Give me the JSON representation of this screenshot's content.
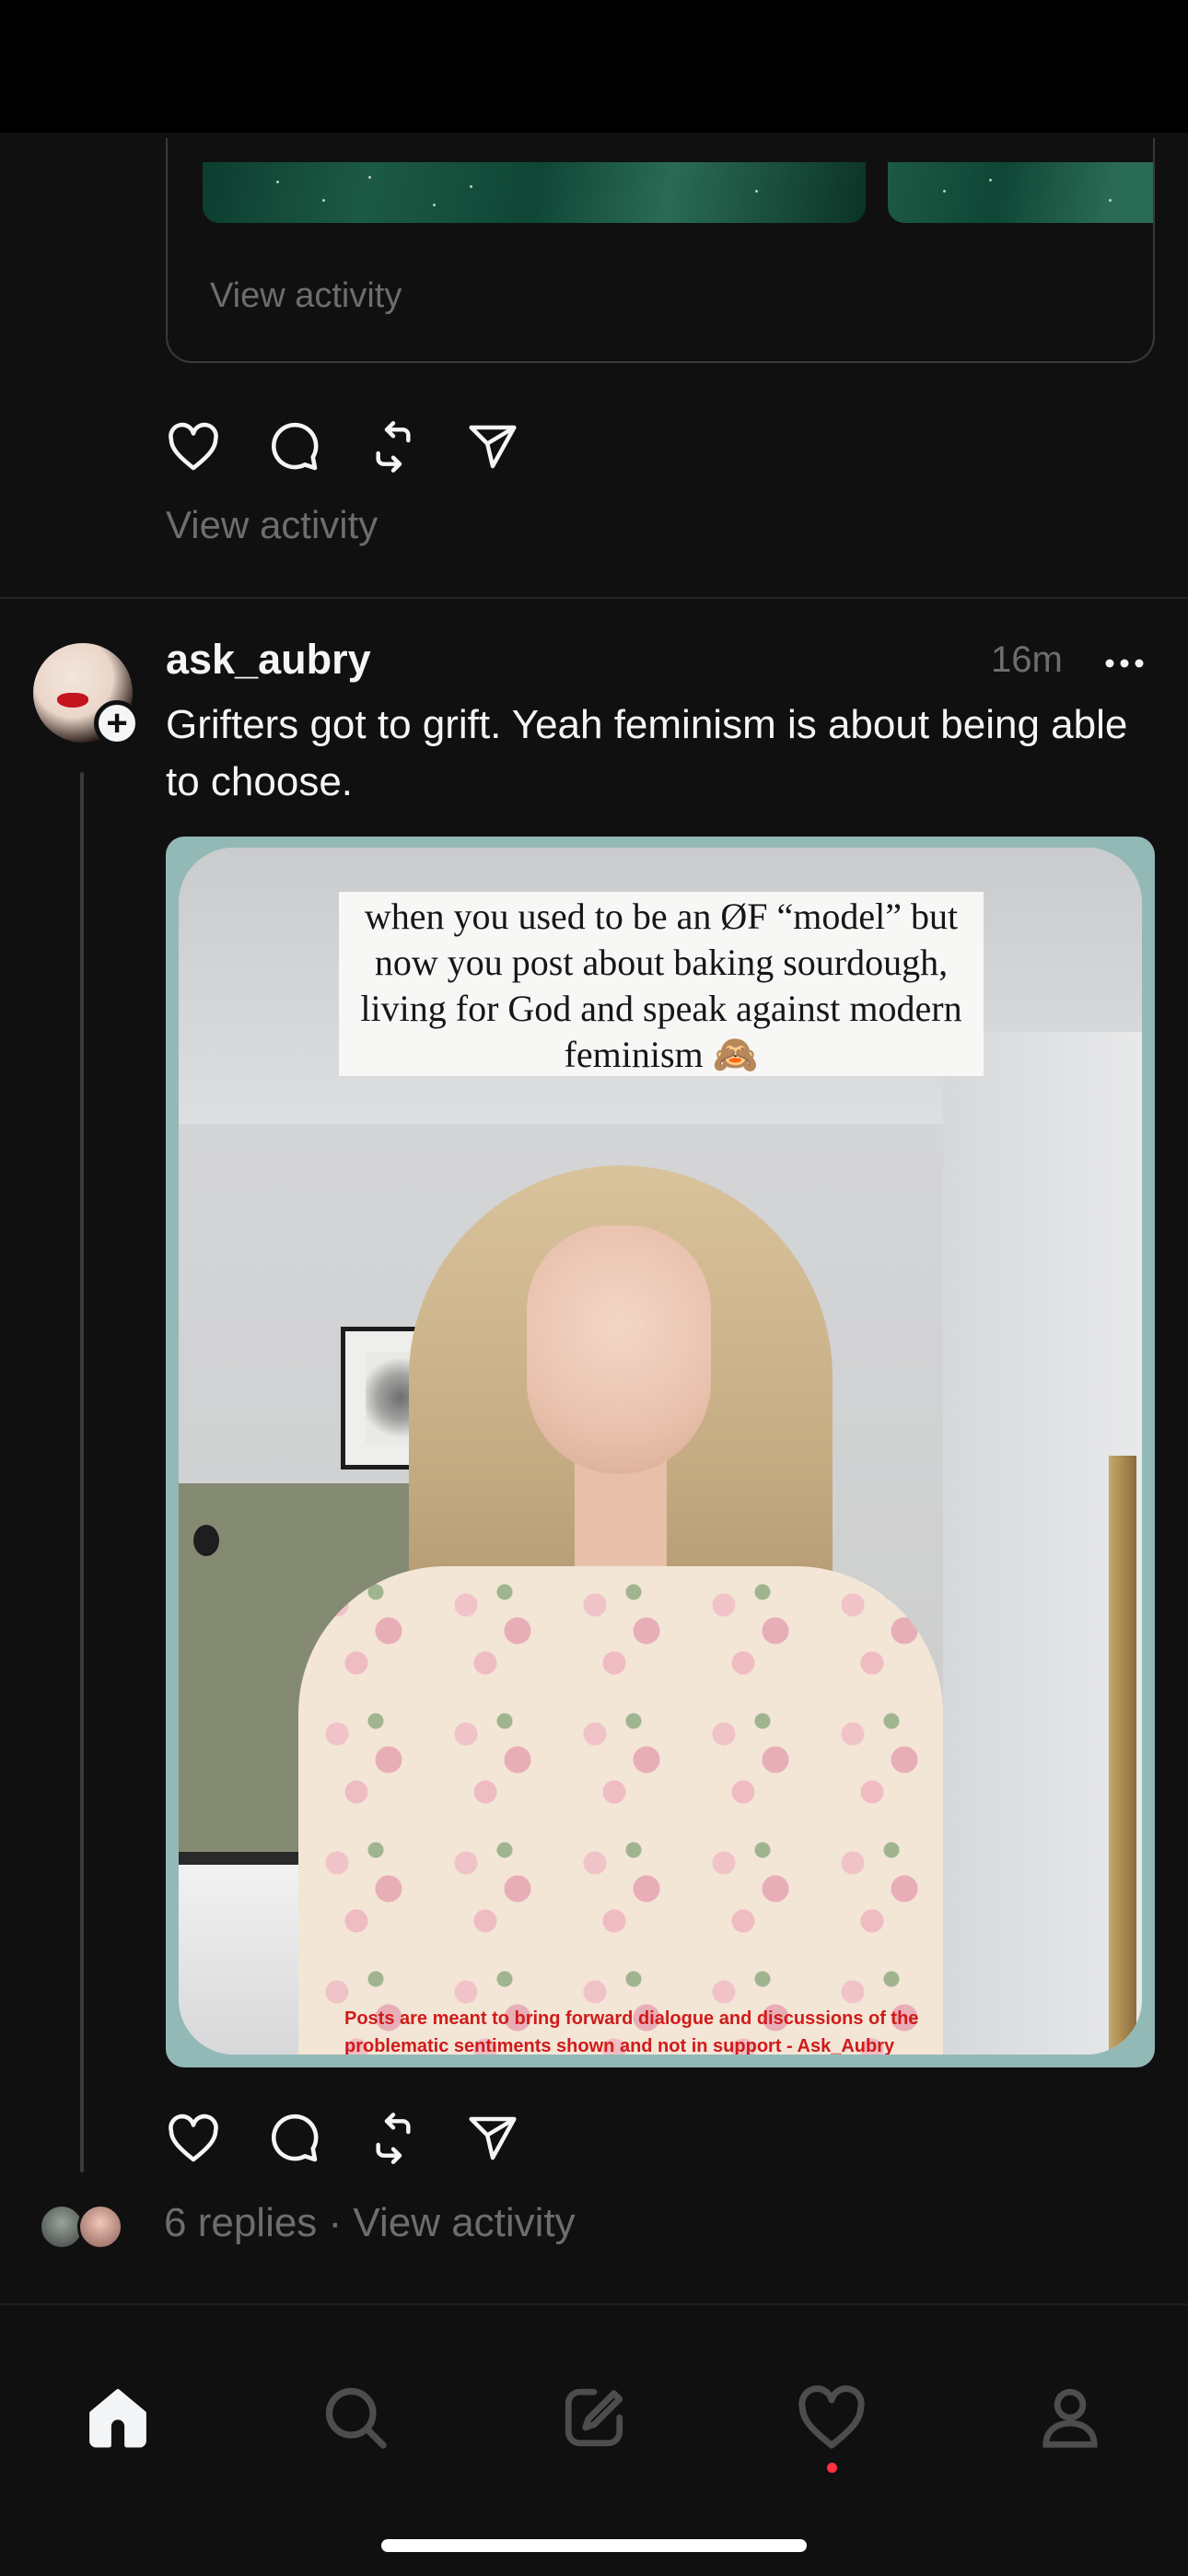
{
  "previous_post": {
    "card_activity_label": "View activity",
    "activity_label": "View activity"
  },
  "post": {
    "username": "ask_aubry",
    "timestamp": "16m",
    "more_icon": "more-horizontal-icon",
    "text": "Grifters got to grift.  Yeah feminism is about being able to choose.",
    "media": {
      "caption": "when you used to be an ØF “model” but now you post about baking sourdough, living for God and speak against modern feminism 🙈",
      "disclaimer": "Posts are meant to bring forward dialogue and discussions of the problematic sentiments shown and not in support - Ask_Aubry"
    },
    "actions": [
      "heart-icon",
      "comment-icon",
      "repost-icon",
      "share-icon"
    ],
    "replies_summary": "6 replies · View activity"
  },
  "bottom_nav": {
    "items": [
      "home-icon",
      "search-icon",
      "compose-icon",
      "activity-heart-icon",
      "profile-icon"
    ],
    "active": "home-icon",
    "notification_dot": true
  },
  "colors": {
    "background": "#101010",
    "text": "#f3f5f7",
    "secondary_text": "#6d6d6d",
    "notification": "#ff3040",
    "disclaimer_red": "#d11a1a"
  }
}
